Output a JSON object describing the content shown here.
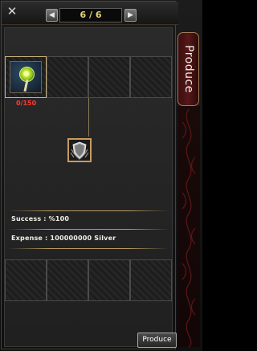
{
  "window": {
    "close_glyph": "✕",
    "page_indicator": "6 / 6",
    "prev_arrow": "◀",
    "next_arrow": "▶",
    "side_tab_label": "Produce"
  },
  "materials": {
    "slots": [
      {
        "item_icon": "lollipop-icon",
        "quantity": "0/150"
      },
      {
        "item_icon": "",
        "quantity": ""
      },
      {
        "item_icon": "",
        "quantity": ""
      },
      {
        "item_icon": "",
        "quantity": ""
      }
    ]
  },
  "result": {
    "item_icon": "shield-emblem-icon"
  },
  "info": {
    "success": "Success : %100",
    "expense": "Expense : 100000000 Silver"
  },
  "bottom_slots": 4,
  "buttons": {
    "produce": "Produce"
  },
  "colors": {
    "quantity_red": "#ff3b2f",
    "page_text": "#e7d27a",
    "tab_red": "#561818",
    "gold_border": "#c99b5e"
  }
}
